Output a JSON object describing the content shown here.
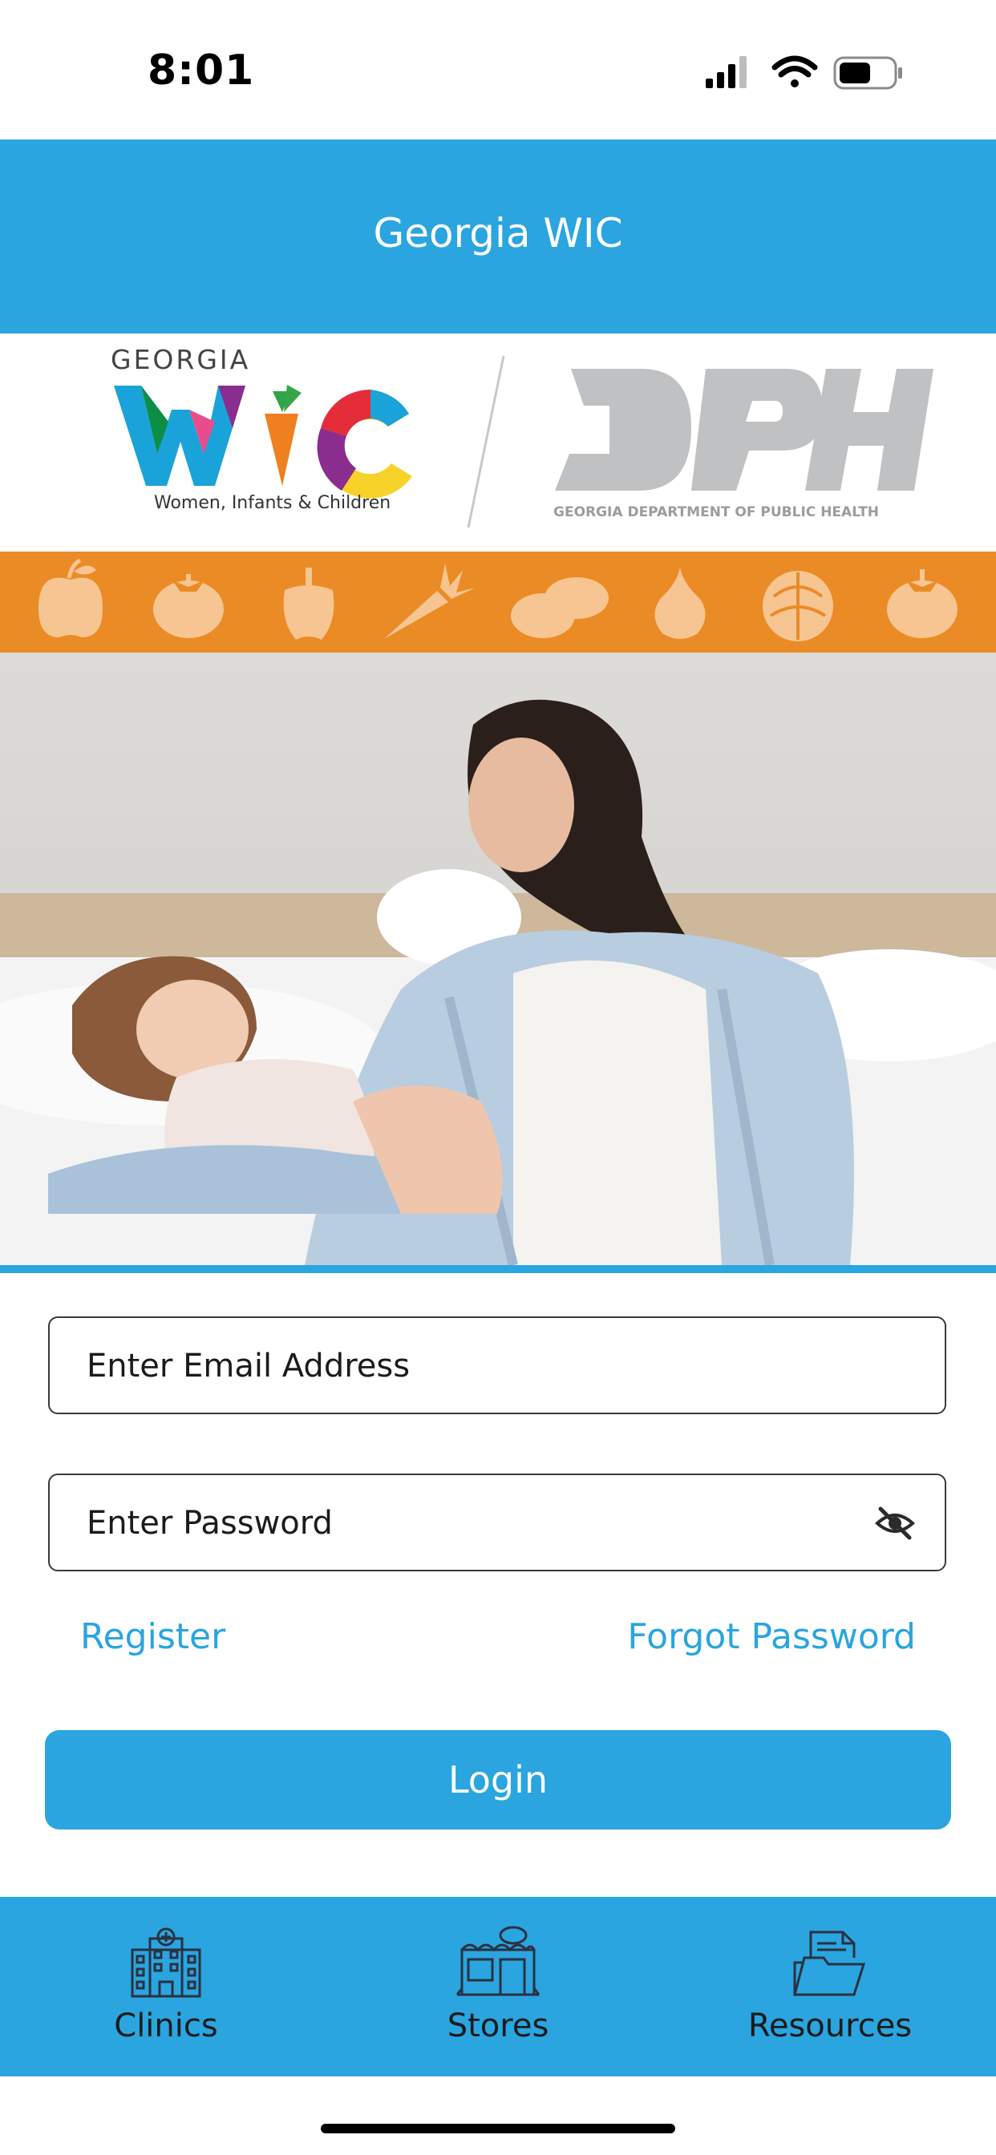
{
  "status_bar": {
    "time": "8:01",
    "signal": "cellular-signal-icon",
    "wifi": "wifi-icon",
    "battery": "battery-icon"
  },
  "header": {
    "title": "Georgia WIC"
  },
  "logos": {
    "wic": {
      "top_text": "GEORGIA",
      "wordmark": "WIC",
      "subtitle": "Women, Infants & Children"
    },
    "dph": {
      "wordmark": "DPH",
      "subtitle": "GEORGIA DEPARTMENT OF PUBLIC HEALTH"
    }
  },
  "produce_icons": [
    "apple-icon",
    "tomato-icon",
    "pepper-icon",
    "carrot-icon",
    "potato-icon",
    "onion-icon",
    "cabbage-icon",
    "tomato-icon"
  ],
  "hero_image": {
    "subject": "mother-and-child-photo"
  },
  "form": {
    "email_placeholder": "Enter Email Address",
    "password_placeholder": "Enter Password",
    "register_label": "Register",
    "forgot_label": "Forgot Password",
    "login_label": "Login"
  },
  "tabs": [
    {
      "label": "Clinics",
      "icon": "hospital-icon"
    },
    {
      "label": "Stores",
      "icon": "store-icon"
    },
    {
      "label": "Resources",
      "icon": "folder-icon"
    }
  ],
  "colors": {
    "primary": "#2aa5df",
    "produce_band": "#eb8b25",
    "produce_icon": "#f6c591"
  }
}
